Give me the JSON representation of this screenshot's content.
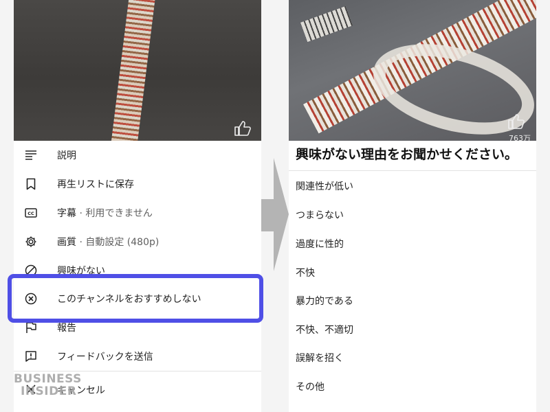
{
  "left_menu": {
    "items": [
      {
        "label": "説明",
        "icon": "description-icon"
      },
      {
        "label": "再生リストに保存",
        "icon": "bookmark-icon"
      },
      {
        "label": "字幕",
        "suffix": " · 利用できません",
        "icon": "captions-icon"
      },
      {
        "label": "画質",
        "suffix": " · 自動設定 (480p)",
        "icon": "gear-icon"
      },
      {
        "label": "興味がない",
        "icon": "block-icon"
      },
      {
        "label": "このチャンネルをおすすめしない",
        "icon": "close-circle-icon",
        "highlighted": true
      },
      {
        "label": "報告",
        "icon": "flag-icon"
      },
      {
        "label": "フィードバックを送信",
        "icon": "feedback-icon"
      }
    ],
    "cancel_label": "キャンセル"
  },
  "right_panel": {
    "view_count": "763万",
    "title": "興味がない理由をお聞かせください。",
    "reasons": [
      "関連性が低い",
      "つまらない",
      "過度に性的",
      "不快",
      "暴力的である",
      "不快、不適切",
      "誤解を招く",
      "その他"
    ]
  },
  "logo": {
    "line1": "BUSINESS",
    "line2": "INSIDER"
  },
  "colors": {
    "highlight": "#4f4fe6",
    "arrow": "#b4b4b4"
  }
}
